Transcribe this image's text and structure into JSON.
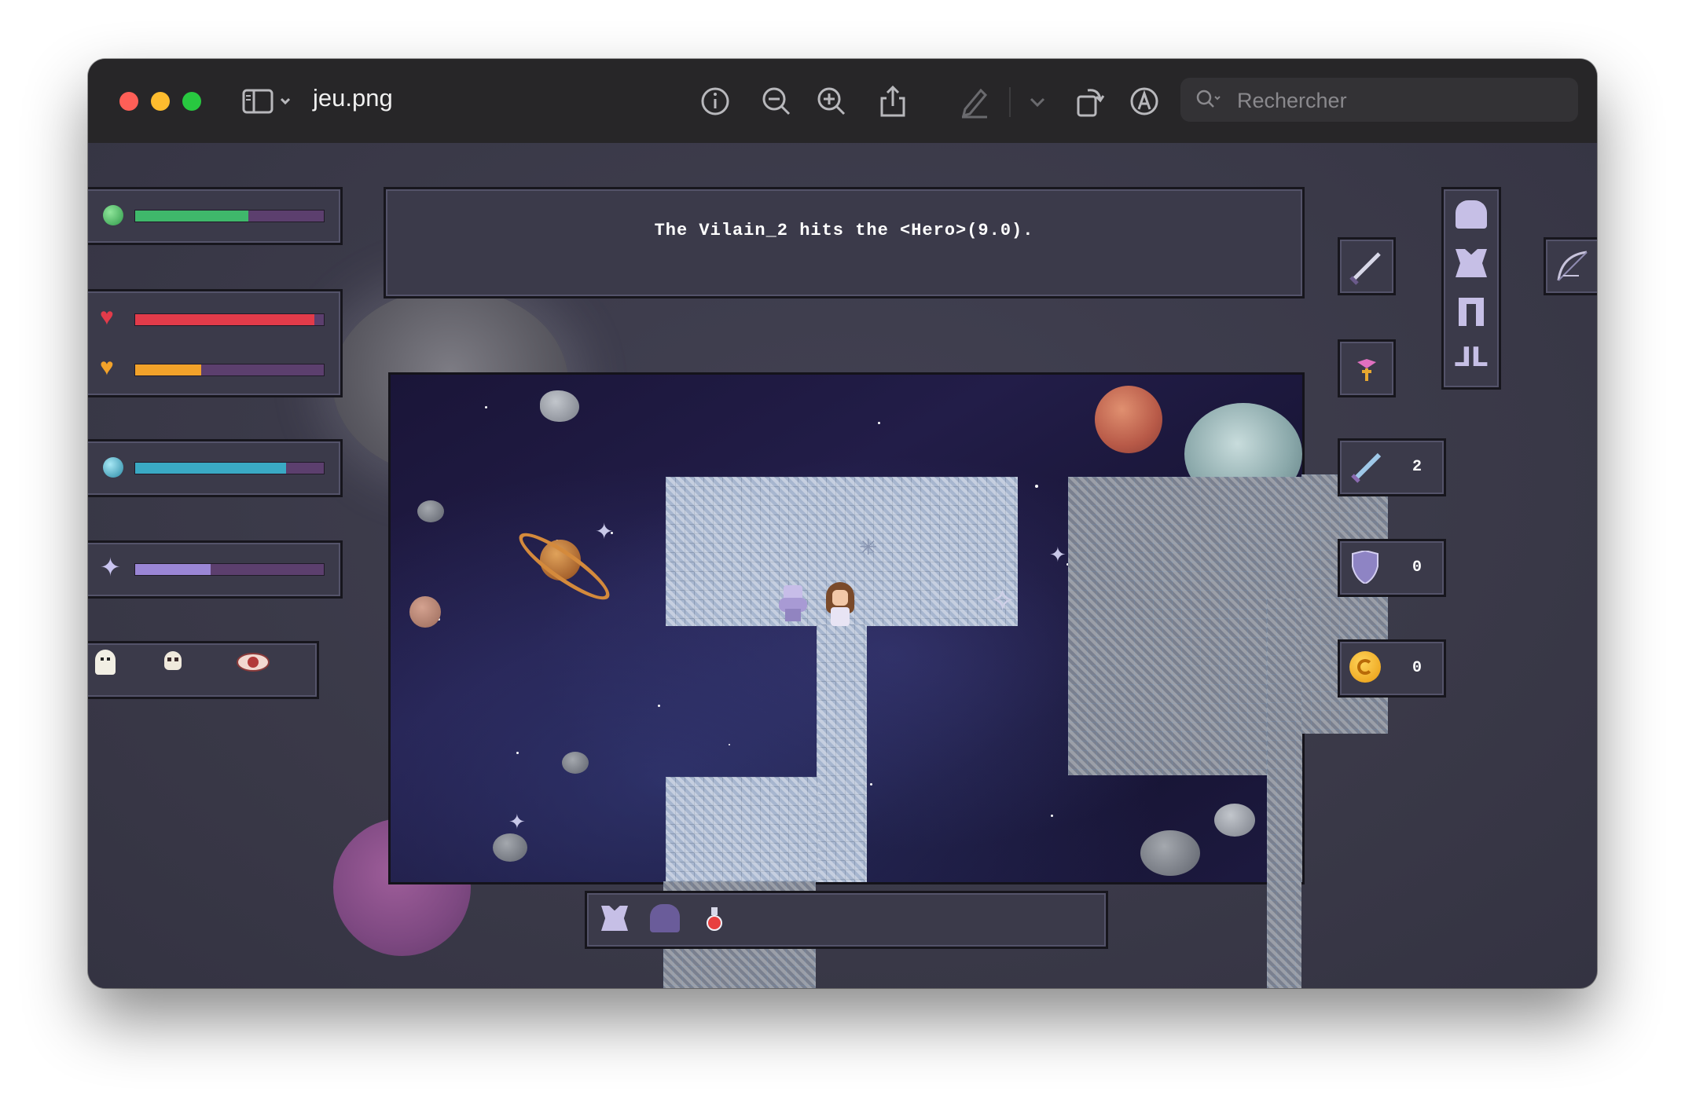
{
  "window": {
    "title": "jeu.png",
    "search_placeholder": "Rechercher"
  },
  "toolbar": {
    "icons": [
      "sidebar-toggle-icon",
      "info-icon",
      "zoom-out-icon",
      "zoom-in-icon",
      "share-icon",
      "markup-pen-icon",
      "rotate-icon",
      "annotate-icon",
      "search-icon"
    ]
  },
  "hud": {
    "stamina_fill": 0.6,
    "health_fill": 0.95,
    "hunger_fill": 0.35,
    "mana_fill": 0.8,
    "experience_fill": 0.4,
    "status_icons": [
      "ghost-icon",
      "skull-icon",
      "eye-icon"
    ]
  },
  "log": {
    "message": "The Vilain_2 hits the <Hero>(9.0)."
  },
  "inventory": {
    "counts": {
      "swords": "2",
      "shields": "0",
      "coins": "0"
    },
    "quickbar_items": [
      "armor-icon",
      "helmet-icon",
      "potion-icon"
    ]
  },
  "colors": {
    "stamina": "#3fb86b",
    "health": "#e23b4a",
    "hunger": "#f2a22a",
    "mana": "#3aa9c4",
    "experience": "#9a86d6",
    "bar_empty": "#5c3f6e"
  }
}
